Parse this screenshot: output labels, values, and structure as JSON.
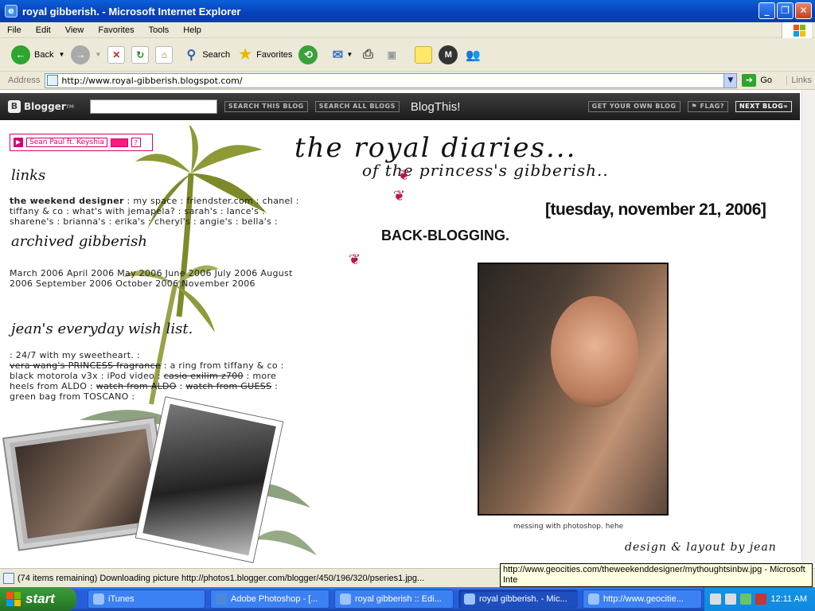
{
  "window": {
    "title": "royal gibberish. - Microsoft Internet Explorer"
  },
  "menu": [
    "File",
    "Edit",
    "View",
    "Favorites",
    "Tools",
    "Help"
  ],
  "toolbar": {
    "back": "Back",
    "search": "Search",
    "favorites": "Favorites"
  },
  "address": {
    "label": "Address",
    "url": "http://www.royal-gibberish.blogspot.com/",
    "go": "Go",
    "links": "Links"
  },
  "blogger": {
    "logo": "Blogger",
    "search_blog": "SEARCH THIS BLOG",
    "search_all": "SEARCH ALL BLOGS",
    "blogthis": "BlogThis!",
    "get_own": "GET YOUR OWN BLOG",
    "flag": "FLAG?",
    "next": "NEXT BLOG»"
  },
  "music": {
    "track": "Sean Paul ft. Keyshia",
    "help": "?"
  },
  "sidebar": {
    "links_heading": "links",
    "links_bold": "the weekend designer",
    "links_rest": " : my space : friendster.com : chanel : tiffany & co : what's with jemapela? : sarah's : lance's : sharene's : brianna's : erika's : cheryl's : angie's : bella's :",
    "archive_heading": "archived gibberish",
    "archive_text": "March 2006 April 2006 May 2006 June 2006 July 2006 August 2006 September 2006 October 2006 November 2006",
    "wish_heading": "jean's everyday wish list.",
    "wish_items": [
      {
        "text": ": 24/7 with my sweetheart. :",
        "strike": false
      },
      {
        "text": " vera wang's PRINCESS fragrance",
        "strike": true
      },
      {
        "text": " : a ring from tiffany & co : black motorola v3x : iPod video : ",
        "strike": false
      },
      {
        "text": "casio exilim z700",
        "strike": true
      },
      {
        "text": " : more heels from ALDO : ",
        "strike": false
      },
      {
        "text": "watch from ALDO",
        "strike": true
      },
      {
        "text": " : ",
        "strike": false
      },
      {
        "text": "watch from GUESS",
        "strike": true
      },
      {
        "text": " : green bag from TOSCANO :",
        "strike": false
      }
    ]
  },
  "main": {
    "title1": "the royal diaries...",
    "title2": "of the princess's gibberish..",
    "date": "[tuesday, november 21, 2006]",
    "post_title": "BACK-BLOGGING.",
    "caption": "messing with photoshop. hehe",
    "credit": "design & layout by jean"
  },
  "status": {
    "text": "(74 items remaining) Downloading picture http://photos1.blogger.com/blogger/450/196/320/pseries1.jpg..."
  },
  "tooltip": {
    "text": "http://www.geocities.com/theweekenddesigner/mythoughtsinbw.jpg - Microsoft Inte"
  },
  "taskbar": {
    "start": "start",
    "tasks": [
      "iTunes",
      "Adobe Photoshop - [...",
      "royal gibberish :: Edi...",
      "royal gibberish. - Mic...",
      "http://www.geocitie..."
    ],
    "clock": "12:11 AM"
  }
}
